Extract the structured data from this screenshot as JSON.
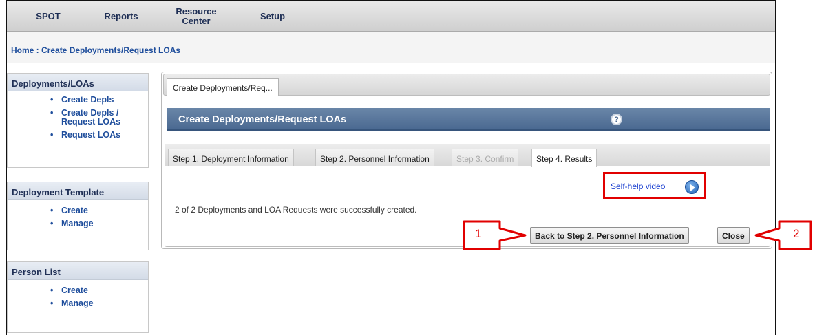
{
  "nav": {
    "items": [
      {
        "label": "SPOT"
      },
      {
        "label": "Reports"
      },
      {
        "label": "Resource Center"
      },
      {
        "label": "Setup"
      }
    ]
  },
  "breadcrumb": "Home : Create Deployments/Request LOAs",
  "sidebar": {
    "panels": [
      {
        "title": "Deployments/LOAs",
        "items": [
          "Create Depls",
          "Create Depls / Request LOAs",
          "Request LOAs"
        ]
      },
      {
        "title": "Deployment Template",
        "items": [
          "Create",
          "Manage"
        ]
      },
      {
        "title": "Person List",
        "items": [
          "Create",
          "Manage"
        ]
      }
    ]
  },
  "main": {
    "outer_tab": "Create Deployments/Req...",
    "title": "Create Deployments/Request LOAs",
    "steps": [
      {
        "label": "Step 1. Deployment Information",
        "state": "enabled"
      },
      {
        "label": "Step 2. Personnel Information",
        "state": "enabled"
      },
      {
        "label": "Step 3. Confirm",
        "state": "disabled"
      },
      {
        "label": "Step 4. Results",
        "state": "active"
      }
    ],
    "self_help": "Self-help video",
    "message": "2 of 2 Deployments and LOA Requests were successfully created.",
    "back_button": "Back to Step 2. Personnel Information",
    "close_button": "Close"
  },
  "callouts": [
    {
      "label": "1"
    },
    {
      "label": "2"
    }
  ],
  "colors": {
    "annotation": "#e10000",
    "title_bar": "#4a6991",
    "link": "#1f4e9c"
  }
}
